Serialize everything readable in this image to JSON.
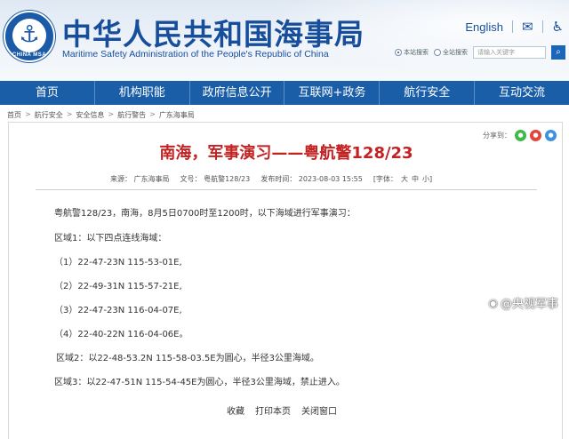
{
  "header": {
    "logo_text": "CHINA MSA",
    "site_title": "中华人民共和国海事局",
    "site_subtitle": "Maritime Safety Administration of the People's Republic of China",
    "english_link": "English",
    "radio_site_search": "本站搜索",
    "radio_full_search": "全站搜索",
    "search_placeholder": "请输入关键字"
  },
  "nav": {
    "items": [
      "首页",
      "机构职能",
      "政府信息公开",
      "互联网+政务",
      "航行安全",
      "互动交流"
    ]
  },
  "breadcrumb": [
    "首页",
    "航行安全",
    "安全信息",
    "航行警告",
    "广东海事局"
  ],
  "share": {
    "label": "分享到："
  },
  "article": {
    "title": "南海，军事演习——粤航警128/23",
    "source": "来源：  广东海事局",
    "doc_no": "文号：  粤航警128/23",
    "date": "发布时间：  2023-08-03 15:55",
    "font_label": "[字体：",
    "font_large": "大",
    "font_medium": "中",
    "font_small": "小]",
    "paragraphs": [
      "粤航警128/23，南海，8月5日0700时至1200时，以下海域进行军事演习：",
      "区域1：以下四点连线海域：",
      "（1）22-47-23N 115-53-01E,",
      "（2）22-49-31N 115-57-21E,",
      "（3）22-47-23N 116-04-07E,",
      "（4）22-40-22N 116-04-06E。",
      "区域2：以22-48-53.2N 115-58-03.5E为圆心，半径3公里海域。",
      "区域3：以22-47-51N 115-54-45E为圆心，半径3公里海域，禁止进入。"
    ]
  },
  "footer": {
    "favorite": "收藏",
    "print": "打印本页",
    "close": "关闭窗口"
  },
  "watermark": "@央视军事",
  "colors": {
    "brand_blue": "#174e9c",
    "nav_blue": "#1b5ea8",
    "title_red": "#c32222"
  }
}
